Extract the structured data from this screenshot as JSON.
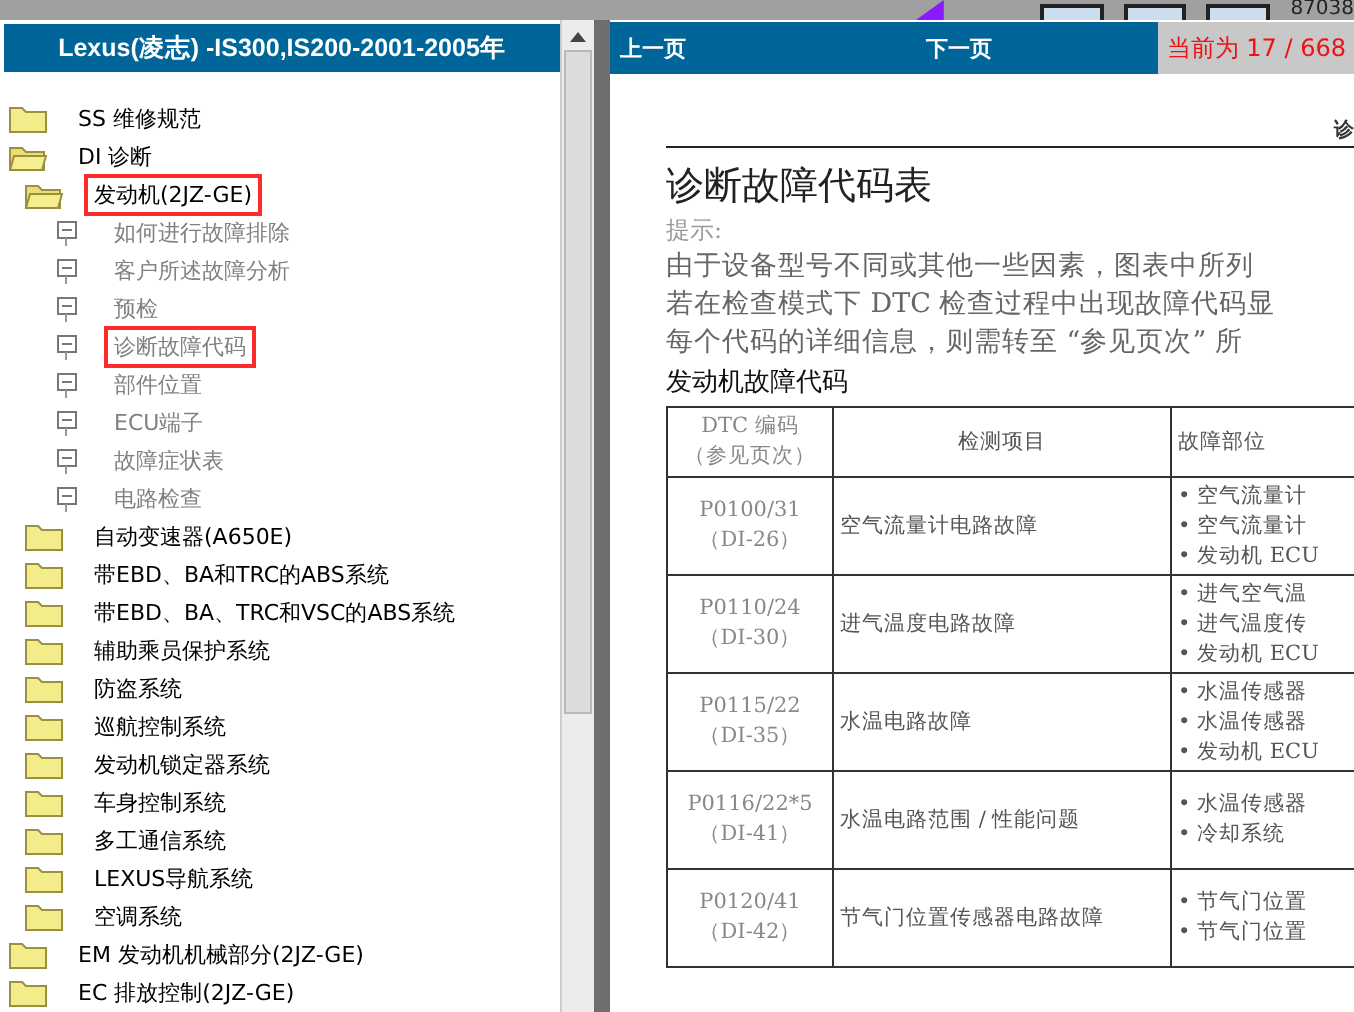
{
  "toolbar": {
    "counter": "87038"
  },
  "sidebar": {
    "title": "Lexus(凌志) -IS300,IS200-2001-2005年",
    "tree": [
      {
        "label": "SS 维修规范",
        "kind": "folder",
        "expanded": false,
        "highlighted": false
      },
      {
        "label": "DI 诊断",
        "kind": "folder",
        "expanded": true,
        "highlighted": false,
        "children": [
          {
            "label": "发动机(2JZ-GE)",
            "kind": "folder",
            "expanded": true,
            "highlighted": true,
            "children": [
              {
                "label": "如何进行故障排除",
                "kind": "page",
                "highlighted": false
              },
              {
                "label": "客户所述故障分析",
                "kind": "page",
                "highlighted": false
              },
              {
                "label": "预检",
                "kind": "page",
                "highlighted": false
              },
              {
                "label": "诊断故障代码",
                "kind": "page",
                "highlighted": true
              },
              {
                "label": "部件位置",
                "kind": "page",
                "highlighted": false
              },
              {
                "label": "ECU端子",
                "kind": "page",
                "highlighted": false
              },
              {
                "label": "故障症状表",
                "kind": "page",
                "highlighted": false
              },
              {
                "label": "电路检查",
                "kind": "page",
                "highlighted": false
              }
            ]
          },
          {
            "label": "自动变速器(A650E)",
            "kind": "folder",
            "expanded": false,
            "highlighted": false
          },
          {
            "label": "带EBD、BA和TRC的ABS系统",
            "kind": "folder",
            "expanded": false,
            "highlighted": false
          },
          {
            "label": "带EBD、BA、TRC和VSC的ABS系统",
            "kind": "folder",
            "expanded": false,
            "highlighted": false
          },
          {
            "label": "辅助乘员保护系统",
            "kind": "folder",
            "expanded": false,
            "highlighted": false
          },
          {
            "label": "防盗系统",
            "kind": "folder",
            "expanded": false,
            "highlighted": false
          },
          {
            "label": "巡航控制系统",
            "kind": "folder",
            "expanded": false,
            "highlighted": false
          },
          {
            "label": "发动机锁定器系统",
            "kind": "folder",
            "expanded": false,
            "highlighted": false
          },
          {
            "label": "车身控制系统",
            "kind": "folder",
            "expanded": false,
            "highlighted": false
          },
          {
            "label": "多工通信系统",
            "kind": "folder",
            "expanded": false,
            "highlighted": false
          },
          {
            "label": "LEXUS导航系统",
            "kind": "folder",
            "expanded": false,
            "highlighted": false
          },
          {
            "label": "空调系统",
            "kind": "folder",
            "expanded": false,
            "highlighted": false
          }
        ]
      },
      {
        "label": "EM 发动机机械部分(2JZ-GE)",
        "kind": "folder",
        "expanded": false,
        "highlighted": false
      },
      {
        "label": "EC 排放控制(2JZ-GE)",
        "kind": "folder",
        "expanded": false,
        "highlighted": false
      }
    ]
  },
  "navigation": {
    "prev": "上一页",
    "next": "下一页",
    "page_indicator": "当前为 17 / 668"
  },
  "document": {
    "header_mark": "诊",
    "title": "诊断故障代码表",
    "hint_label": "提示:",
    "hint_lines": [
      "由于设备型号不同或其他一些因素，图表中所列",
      "若在检查模式下 DTC 检查过程中出现故障代码显",
      "每个代码的详细信息，则需转至 “参见页次” 所"
    ],
    "section": "发动机故障代码",
    "table": {
      "columns": [
        [
          "DTC 编码",
          "（参见页次）"
        ],
        [
          "检测项目"
        ],
        [
          "故障部位"
        ]
      ],
      "rows": [
        {
          "code": "P0100/31",
          "ref": "（DI-26）",
          "item": "空气流量计电路故障",
          "parts": [
            "• 空气流量计",
            "• 空气流量计",
            "• 发动机 ECU"
          ]
        },
        {
          "code": "P0110/24",
          "ref": "（DI-30）",
          "item": "进气温度电路故障",
          "parts": [
            "• 进气空气温",
            "• 进气温度传",
            "• 发动机 ECU"
          ]
        },
        {
          "code": "P0115/22",
          "ref": "（DI-35）",
          "item": "水温电路故障",
          "parts": [
            "• 水温传感器",
            "• 水温传感器",
            "• 发动机 ECU"
          ]
        },
        {
          "code": "P0116/22*5",
          "ref": "（DI-41）",
          "item": "水温电路范围 / 性能问题",
          "parts": [
            "• 水温传感器",
            "• 冷却系统"
          ]
        },
        {
          "code": "P0120/41",
          "ref": "（DI-42）",
          "item": "节气门位置传感器电路故障",
          "parts": [
            "• 节气门位置",
            "• 节气门位置"
          ]
        }
      ]
    }
  }
}
